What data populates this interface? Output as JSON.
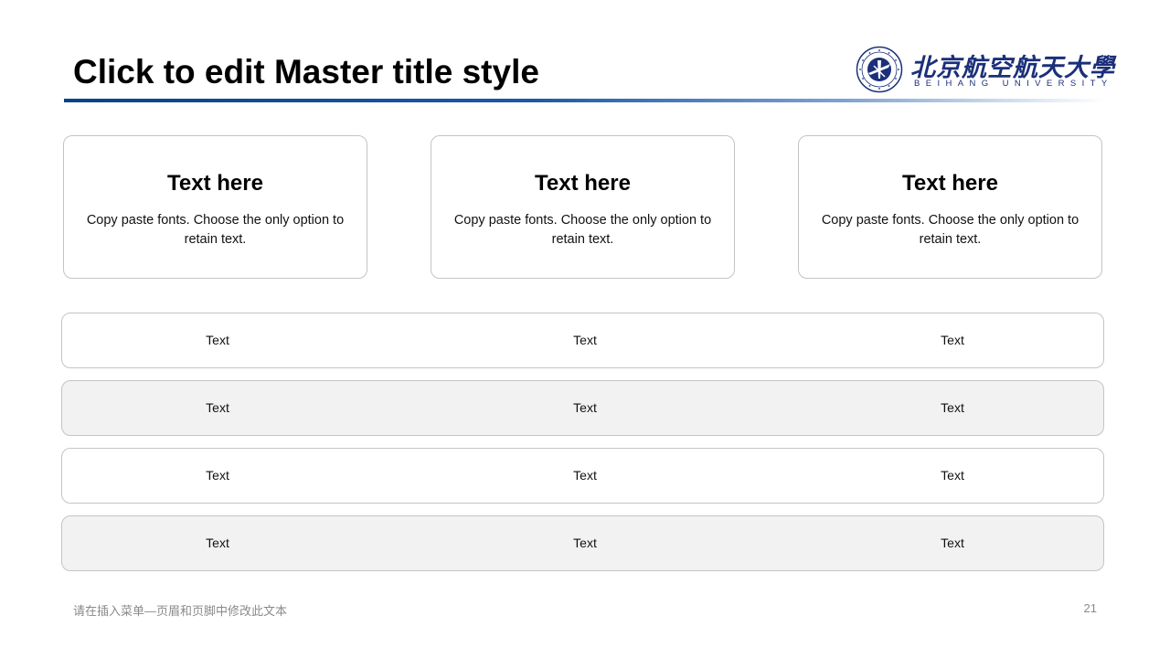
{
  "slide": {
    "title": "Click to edit Master title style",
    "logo": {
      "name_cn": "北京航空航天大學",
      "name_en": "BEIHANG UNIVERSITY",
      "emblem_icon": "university-seal-icon",
      "color": "#1b2f7a"
    },
    "accent_color": "#0b3f8f"
  },
  "cards": [
    {
      "title": "Text here",
      "body": "Copy paste fonts. Choose the only option to retain text."
    },
    {
      "title": "Text here",
      "body": "Copy paste fonts. Choose the only option to retain text."
    },
    {
      "title": "Text here",
      "body": "Copy paste fonts. Choose the only option to retain text."
    }
  ],
  "rows": [
    {
      "cells": [
        "Text",
        "Text",
        "Text"
      ]
    },
    {
      "cells": [
        "Text",
        "Text",
        "Text"
      ]
    },
    {
      "cells": [
        "Text",
        "Text",
        "Text"
      ]
    },
    {
      "cells": [
        "Text",
        "Text",
        "Text"
      ]
    }
  ],
  "footer": {
    "text": "请在插入菜单—页眉和页脚中修改此文本",
    "page_number": "21"
  }
}
